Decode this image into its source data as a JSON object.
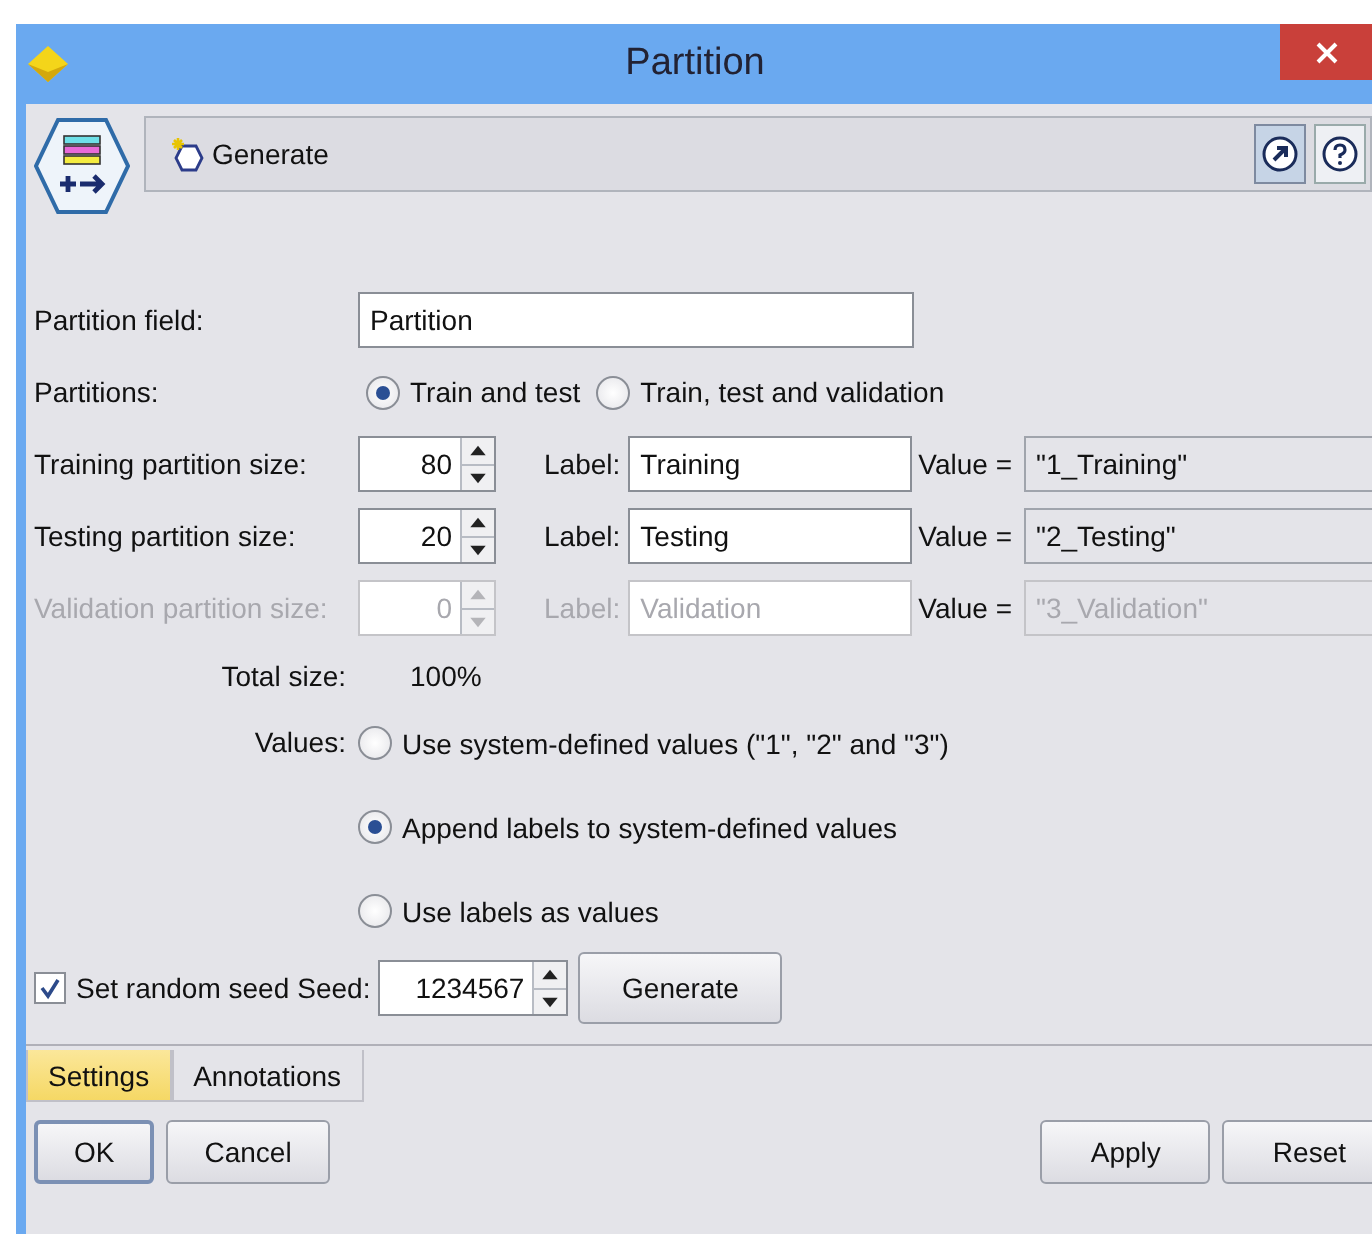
{
  "window": {
    "title": "Partition"
  },
  "toolbar": {
    "generate_menu": "Generate"
  },
  "partition_field": {
    "label": "Partition field:",
    "value": "Partition"
  },
  "partitions": {
    "label": "Partitions:",
    "options": [
      {
        "label": "Train and test",
        "selected": true
      },
      {
        "label": "Train, test and validation",
        "selected": false
      }
    ]
  },
  "sizes": [
    {
      "label": "Training partition size:",
      "size": "80",
      "label_caption": "Label:",
      "label_value": "Training",
      "value_caption": "Value =",
      "value": "\"1_Training\"",
      "disabled": false
    },
    {
      "label": "Testing partition size:",
      "size": "20",
      "label_caption": "Label:",
      "label_value": "Testing",
      "value_caption": "Value =",
      "value": "\"2_Testing\"",
      "disabled": false
    },
    {
      "label": "Validation partition size:",
      "size": "0",
      "label_caption": "Label:",
      "label_value": "Validation",
      "value_caption": "Value =",
      "value": "\"3_Validation\"",
      "disabled": true
    }
  ],
  "total": {
    "label": "Total size:",
    "value": "100%"
  },
  "values": {
    "label": "Values:",
    "options": [
      {
        "label": "Use system-defined values (\"1\", \"2\" and \"3\")",
        "selected": false
      },
      {
        "label": "Append labels to system-defined values",
        "selected": true
      },
      {
        "label": "Use labels as values",
        "selected": false
      }
    ]
  },
  "seed": {
    "label": "Set random seed",
    "checked": true,
    "seed_label": "Seed:",
    "value": "1234567",
    "button": "Generate"
  },
  "tabs": [
    {
      "label": "Settings",
      "selected": true
    },
    {
      "label": "Annotations",
      "selected": false
    }
  ],
  "buttons_left": [
    "OK",
    "Cancel"
  ],
  "buttons_right": [
    "Apply",
    "Reset"
  ]
}
